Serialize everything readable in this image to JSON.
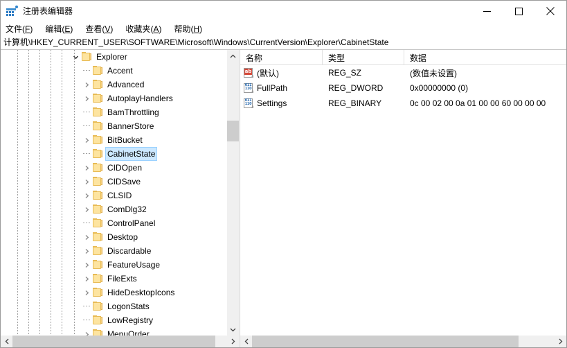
{
  "window": {
    "title": "注册表编辑器",
    "app_icon": "registry-editor-icon",
    "controls": {
      "minimize": "最小化",
      "maximize": "最大化",
      "close": "关闭"
    }
  },
  "menubar": {
    "items": [
      {
        "label": "文件",
        "accel": "F"
      },
      {
        "label": "编辑",
        "accel": "E"
      },
      {
        "label": "查看",
        "accel": "V"
      },
      {
        "label": "收藏夹",
        "accel": "A"
      },
      {
        "label": "帮助",
        "accel": "H"
      }
    ]
  },
  "address": {
    "path": "计算机\\HKEY_CURRENT_USER\\SOFTWARE\\Microsoft\\Windows\\CurrentVersion\\Explorer\\CabinetState"
  },
  "tree": {
    "items": [
      {
        "label": "Explorer",
        "depth": 0,
        "state": "expanded",
        "selected": false
      },
      {
        "label": "Accent",
        "depth": 1,
        "state": "leaf",
        "selected": false
      },
      {
        "label": "Advanced",
        "depth": 1,
        "state": "collapsed",
        "selected": false
      },
      {
        "label": "AutoplayHandlers",
        "depth": 1,
        "state": "collapsed",
        "selected": false
      },
      {
        "label": "BamThrottling",
        "depth": 1,
        "state": "leaf",
        "selected": false
      },
      {
        "label": "BannerStore",
        "depth": 1,
        "state": "leaf",
        "selected": false
      },
      {
        "label": "BitBucket",
        "depth": 1,
        "state": "collapsed",
        "selected": false
      },
      {
        "label": "CabinetState",
        "depth": 1,
        "state": "leaf",
        "selected": true
      },
      {
        "label": "CIDOpen",
        "depth": 1,
        "state": "collapsed",
        "selected": false
      },
      {
        "label": "CIDSave",
        "depth": 1,
        "state": "collapsed",
        "selected": false
      },
      {
        "label": "CLSID",
        "depth": 1,
        "state": "collapsed",
        "selected": false
      },
      {
        "label": "ComDlg32",
        "depth": 1,
        "state": "collapsed",
        "selected": false
      },
      {
        "label": "ControlPanel",
        "depth": 1,
        "state": "leaf",
        "selected": false
      },
      {
        "label": "Desktop",
        "depth": 1,
        "state": "collapsed",
        "selected": false
      },
      {
        "label": "Discardable",
        "depth": 1,
        "state": "collapsed",
        "selected": false
      },
      {
        "label": "FeatureUsage",
        "depth": 1,
        "state": "collapsed",
        "selected": false
      },
      {
        "label": "FileExts",
        "depth": 1,
        "state": "collapsed",
        "selected": false
      },
      {
        "label": "HideDesktopIcons",
        "depth": 1,
        "state": "collapsed",
        "selected": false
      },
      {
        "label": "LogonStats",
        "depth": 1,
        "state": "leaf",
        "selected": false
      },
      {
        "label": "LowRegistry",
        "depth": 1,
        "state": "leaf",
        "selected": false
      },
      {
        "label": "MenuOrder",
        "depth": 1,
        "state": "collapsed",
        "selected": false
      }
    ]
  },
  "values": {
    "columns": [
      "名称",
      "类型",
      "数据"
    ],
    "rows": [
      {
        "icon": "string-value-icon",
        "name": "(默认)",
        "type": "REG_SZ",
        "data": "(数值未设置)"
      },
      {
        "icon": "binary-value-icon",
        "name": "FullPath",
        "type": "REG_DWORD",
        "data": "0x00000000 (0)"
      },
      {
        "icon": "binary-value-icon",
        "name": "Settings",
        "type": "REG_BINARY",
        "data": "0c 00 02 00 0a 01 00 00 60 00 00 00"
      }
    ]
  },
  "colors": {
    "selection": "#cce8ff",
    "selection_border": "#99d1ff",
    "folder": "#fde4a0",
    "folder_edge": "#e8bb55",
    "scrollbar_track": "#f0f0f0",
    "scrollbar_thumb": "#cdcdcd",
    "string_icon": "#d64a3a",
    "binary_icon": "#2b6cb0",
    "window_border": "#9b9b9b"
  }
}
